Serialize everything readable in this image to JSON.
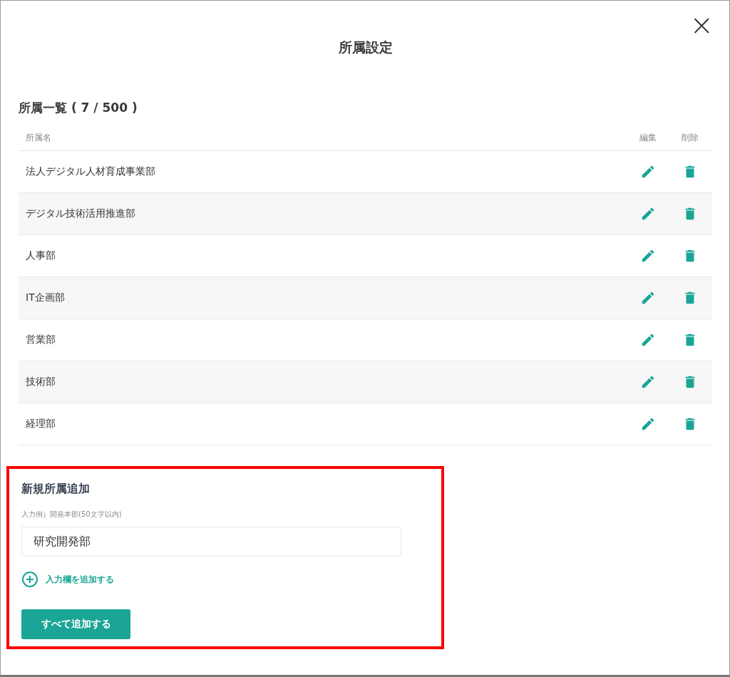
{
  "dialog": {
    "title": "所属設定",
    "close_icon": "×"
  },
  "list": {
    "heading": "所属一覧 ( 7 / 500 )",
    "columns": [
      "所属名",
      "編集",
      "削除"
    ],
    "rows": [
      {
        "name": "法人デジタル人材育成事業部"
      },
      {
        "name": "デジタル技術活用推進部"
      },
      {
        "name": "人事部"
      },
      {
        "name": "IT企画部"
      },
      {
        "name": "営業部"
      },
      {
        "name": "技術部"
      },
      {
        "name": "経理部"
      }
    ]
  },
  "new_section": {
    "heading": "新規所属追加",
    "field_label": "入力例）開発本部(50文字以内)",
    "field_value": "研究開発部",
    "add_field_link": "入力欄を追加する",
    "submit_button": "すべて追加する",
    "highlighted": true
  }
}
